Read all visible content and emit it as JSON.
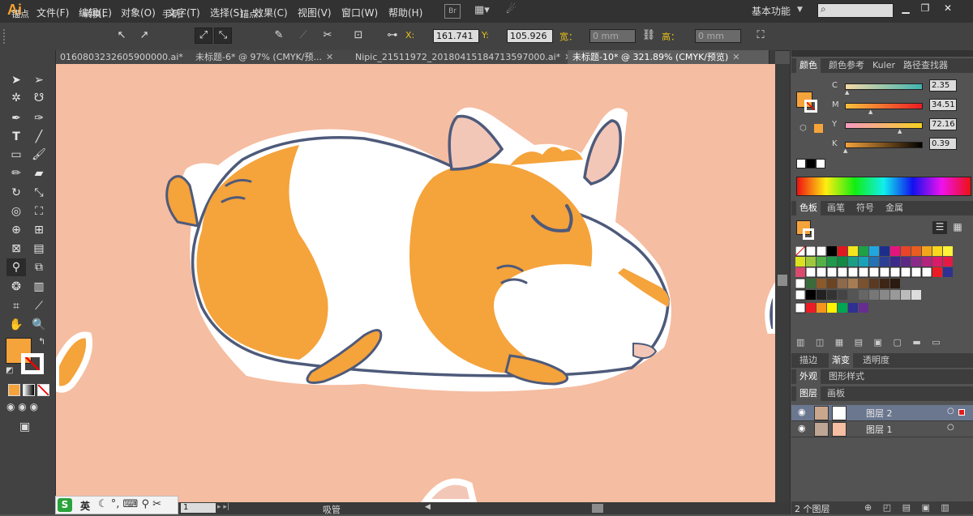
{
  "app": {
    "logo": "Ai"
  },
  "menu": [
    "文件(F)",
    "编辑(E)",
    "对象(O)",
    "文字(T)",
    "选择(S)",
    "效果(C)",
    "视图(V)",
    "窗口(W)",
    "帮助(H)"
  ],
  "menu_icons": {
    "bridge": "Br"
  },
  "workspace": {
    "label": "基本功能"
  },
  "control": {
    "mode": "锚点",
    "convert": "转换：",
    "handles": "手柄：",
    "anchors": "锚点：",
    "x_label": "X:",
    "x_value": "161.741 ",
    "y_label": "Y:",
    "y_value": "105.926 ",
    "w_label": "宽：",
    "w_value": "0 mm",
    "h_label": "高：",
    "h_value": "0 mm"
  },
  "tabs": [
    {
      "label": "0160803232605900000.ai*",
      "active": false
    },
    {
      "label": "未标题-6* @ 97% (CMYK/预...",
      "active": false
    },
    {
      "label": "Nipic_21511972_20180415184713597000.ai*",
      "active": false
    },
    {
      "label": "未标题-10* @ 321.89% (CMYK/预览)",
      "active": true
    }
  ],
  "color_panel": {
    "tabs": [
      "颜色",
      "颜色参考",
      "Kuler",
      "路径查找器"
    ],
    "channels": [
      {
        "name": "C",
        "value": "2.35",
        "pos": 0.03
      },
      {
        "name": "M",
        "value": "34.51",
        "pos": 0.35
      },
      {
        "name": "Y",
        "value": "72.16",
        "pos": 0.72
      },
      {
        "name": "K",
        "value": "0.39",
        "pos": 0.01
      }
    ],
    "fill_color": "#f5a33b"
  },
  "swatches_panel": {
    "tabs": [
      "色板",
      "画笔",
      "符号",
      "金属"
    ]
  },
  "gradient_panel": {
    "tabs": [
      "描边",
      "渐变",
      "透明度"
    ]
  },
  "appearance_panel": {
    "tabs": [
      "外观",
      "图形样式"
    ]
  },
  "layers_panel": {
    "tabs": [
      "图层",
      "画板"
    ],
    "layers": [
      {
        "name": "图层 2",
        "selected": true
      },
      {
        "name": "图层 1",
        "selected": false
      }
    ],
    "footer": "2 个图层"
  },
  "status": {
    "zoom": "1",
    "tool": "吸管"
  },
  "ime": {
    "lang": "英"
  },
  "colors": {
    "accent": "#f7a02c",
    "artboard": "#f5bda1",
    "fur_orange": "#f5a33b",
    "outline": "#4e5a7a"
  }
}
